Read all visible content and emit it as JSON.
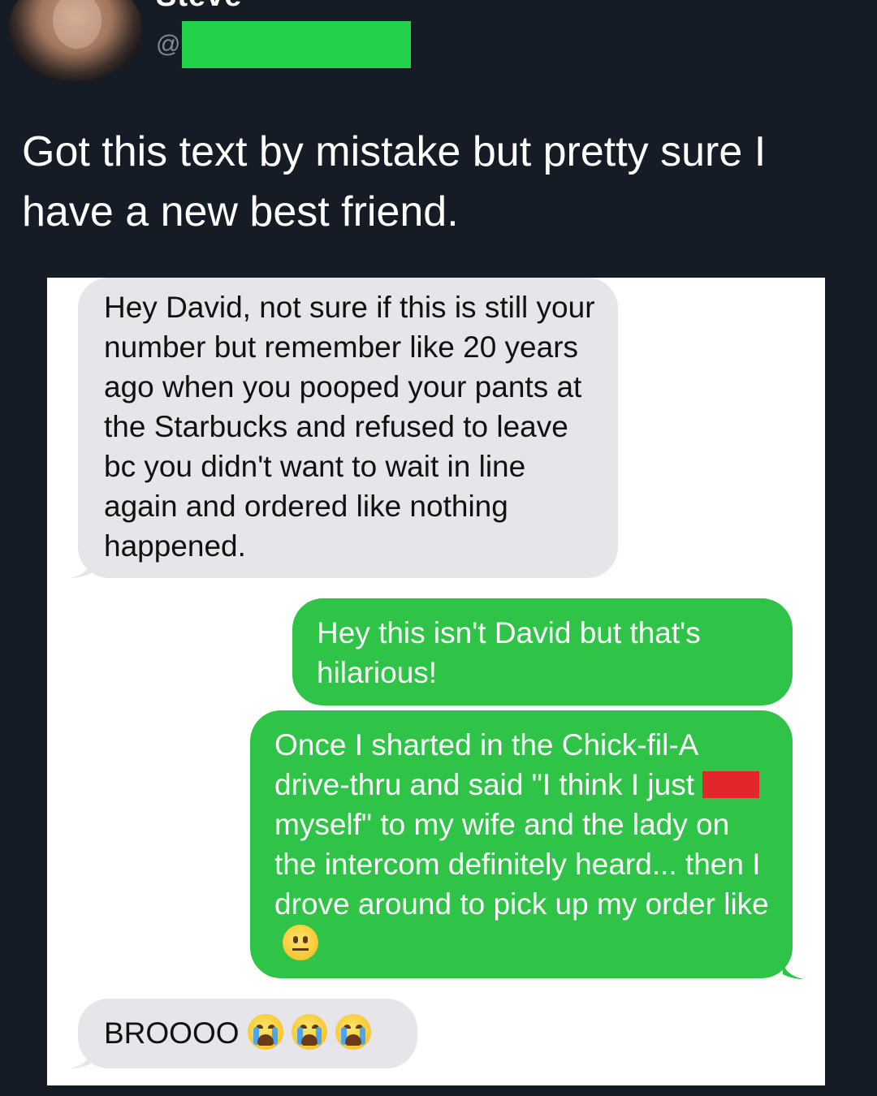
{
  "tweet": {
    "display_name": "Steve",
    "handle_prefix": "@",
    "text": "Got this text by mistake but pretty sure I have a new best friend."
  },
  "conversation": {
    "messages": [
      {
        "direction": "received",
        "text": "Hey David, not sure if this is still your number but remember like 20 years ago when you pooped your pants at the Starbucks and refused to leave bc you didn't want to wait in line again and ordered like nothing happened."
      },
      {
        "direction": "sent",
        "text": "Hey this isn't David but that's hilarious!"
      },
      {
        "direction": "sent",
        "text_part1": "Once I sharted in the Chick-fil-A drive-thru and said \"I think I just",
        "text_part2": "myself\" to my wife and the lady on the intercom definitely heard... then I drove around to pick up my order like",
        "emoji": "neutral-face-emoji"
      },
      {
        "direction": "received",
        "text": "BROOOO",
        "emoji": "loudly-crying-face-emoji",
        "emoji_count": 3
      }
    ]
  },
  "colors": {
    "page_background": "#161c26",
    "sent_bubble": "#2fc347",
    "received_bubble": "#e5e5ea",
    "handle_redaction": "#22d34a",
    "word_redaction": "#e3262b"
  }
}
